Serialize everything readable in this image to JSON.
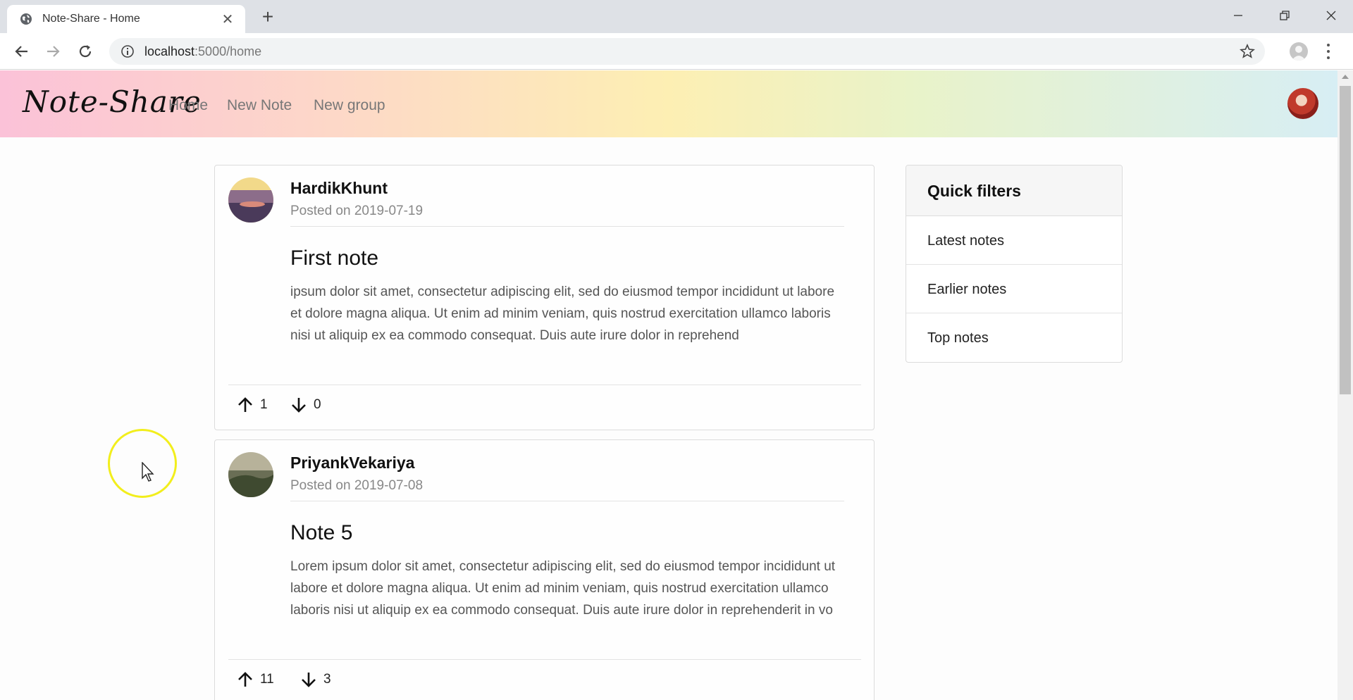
{
  "browser": {
    "tab_title": "Note-Share - Home",
    "url_host": "localhost",
    "url_path": ":5000/home"
  },
  "site": {
    "brand": "Note-Share",
    "nav": [
      "Home",
      "New Note",
      "New group"
    ]
  },
  "notes": [
    {
      "author": "HardikKhunt",
      "posted": "Posted on 2019-07-19",
      "title": "First note",
      "body": "ipsum dolor sit amet, consectetur adipiscing elit, sed do eiusmod tempor incididunt ut labore et dolore magna aliqua. Ut enim ad minim veniam, quis nostrud exercitation ullamco laboris nisi ut aliquip ex ea commodo consequat. Duis aute irure dolor in reprehend",
      "upvotes": "1",
      "downvotes": "0"
    },
    {
      "author": "PriyankVekariya",
      "posted": "Posted on 2019-07-08",
      "title": "Note 5",
      "body": "Lorem ipsum dolor sit amet, consectetur adipiscing elit, sed do eiusmod tempor incididunt ut labore et dolore magna aliqua. Ut enim ad minim veniam, quis nostrud exercitation ullamco laboris nisi ut aliquip ex ea commodo consequat. Duis aute irure dolor in reprehenderit in vo",
      "upvotes": "11",
      "downvotes": "3"
    }
  ],
  "filters": {
    "title": "Quick filters",
    "items": [
      "Latest notes",
      "Earlier notes",
      "Top notes"
    ]
  },
  "colors": {
    "cursor_highlight": "#f2ee1c"
  }
}
